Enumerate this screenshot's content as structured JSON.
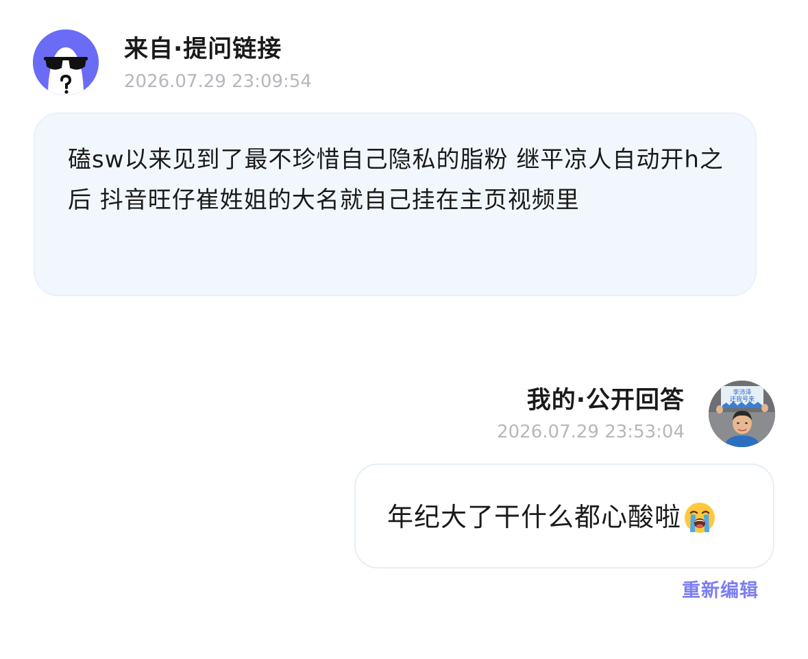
{
  "question": {
    "avatar_icon": "anonymous-sunglasses-ghost-icon",
    "avatar_color": "#6a6cf6",
    "title": "来自·提问链接",
    "timestamp": "2026.07.29 23:09:54",
    "text": "磕sw以来见到了最不珍惜自己隐私的脂粉 继平凉人自动开h之后 抖音旺仔崔姓姐的大名就自己挂在主页视频里"
  },
  "answer": {
    "title": "我的·公开回答",
    "timestamp": "2026.07.29 23:53:04",
    "avatar_sign_line1": "李沛泽",
    "avatar_sign_line2": "还我号来",
    "text": "年纪大了干什么都心酸啦",
    "emoji_icon": "loudly-crying-face-icon",
    "edit_label": "重新编辑",
    "accent_color": "#7b7ef2"
  }
}
